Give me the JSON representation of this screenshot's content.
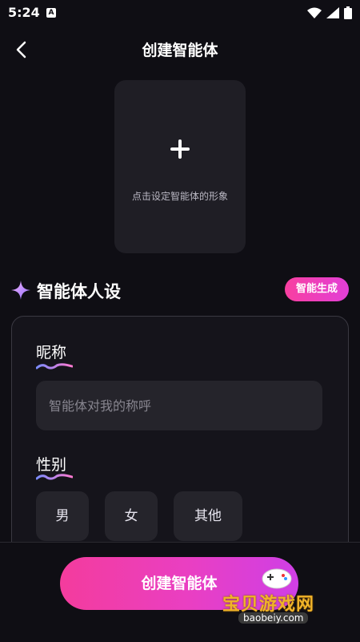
{
  "status_bar": {
    "time": "5:24",
    "notification_icon": "A"
  },
  "header": {
    "title": "创建智能体"
  },
  "avatar": {
    "hint": "点击设定智能体的形象"
  },
  "persona_section": {
    "title": "智能体人设",
    "generate_button": "智能生成"
  },
  "form": {
    "nickname": {
      "label": "昵称",
      "placeholder": "智能体对我的称呼",
      "value": ""
    },
    "gender": {
      "label": "性别",
      "options": [
        "男",
        "女",
        "其他"
      ]
    }
  },
  "footer": {
    "create_button": "创建智能体"
  },
  "watermark": {
    "text": "宝贝游戏网",
    "url": "baobeiy.com"
  },
  "colors": {
    "accent_pink": "#f43c9d",
    "accent_purple": "#cf3fe6",
    "background": "#0f0e14"
  }
}
